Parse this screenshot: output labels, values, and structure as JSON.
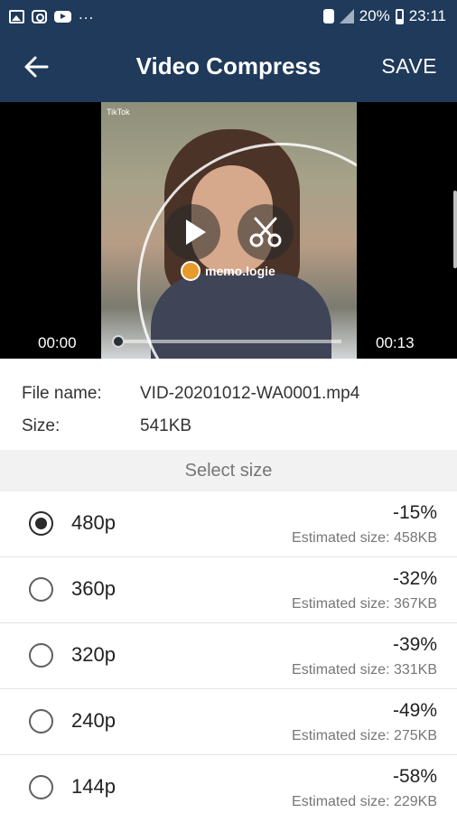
{
  "status_bar": {
    "notification_icons": [
      "gallery-icon",
      "instagram-icon",
      "youtube-icon"
    ],
    "more": "...",
    "battery": "20%",
    "time": "23:11"
  },
  "app_bar": {
    "title": "Video Compress",
    "save_label": "SAVE",
    "back_icon": "arrow-left-icon",
    "background": "#1f3a5a"
  },
  "video": {
    "watermark_app": "TikTok",
    "watermark_user": "memo.logie",
    "time_start": "00:00",
    "time_end": "00:13",
    "progress": 0
  },
  "file": {
    "name_label": "File name:",
    "name_value": "VID-20201012-WA0001.mp4",
    "size_label": "Size:",
    "size_value": "541KB"
  },
  "select_size_label": "Select size",
  "options": [
    {
      "label": "480p",
      "percent": "-15%",
      "estimate": "Estimated size: 458KB",
      "selected": true
    },
    {
      "label": "360p",
      "percent": "-32%",
      "estimate": "Estimated size: 367KB",
      "selected": false
    },
    {
      "label": "320p",
      "percent": "-39%",
      "estimate": "Estimated size: 331KB",
      "selected": false
    },
    {
      "label": "240p",
      "percent": "-49%",
      "estimate": "Estimated size: 275KB",
      "selected": false
    },
    {
      "label": "144p",
      "percent": "-58%",
      "estimate": "Estimated size: 229KB",
      "selected": false
    }
  ]
}
